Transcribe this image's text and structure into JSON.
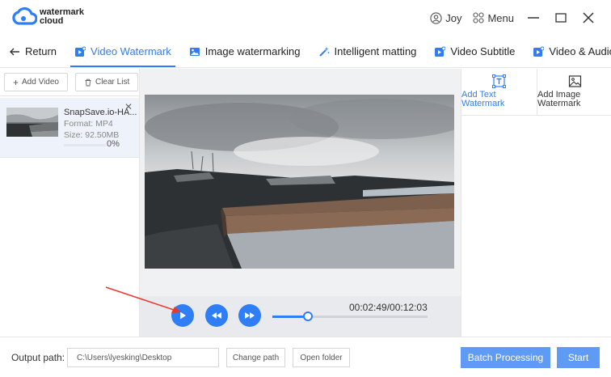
{
  "app": {
    "logo_line1": "watermark",
    "logo_line2": "cloud",
    "user_name": "Joy",
    "menu_label": "Menu",
    "accent_color": "#2f7ef5"
  },
  "tabs": [
    {
      "label": "Return",
      "icon": "arrow-left-icon"
    },
    {
      "label": "Video Watermark",
      "icon": "video-icon",
      "active": true
    },
    {
      "label": "Image watermarking",
      "icon": "image-icon"
    },
    {
      "label": "Intelligent matting",
      "icon": "magic-wand-icon"
    },
    {
      "label": "Video Subtitle",
      "icon": "video-subtitle-icon"
    },
    {
      "label": "Video & Audio Sepa",
      "icon": "video-audio-icon"
    }
  ],
  "left_panel": {
    "add_video_label": "Add Video",
    "clear_list_label": "Clear List",
    "file": {
      "name": "SnapSave.io-HA...",
      "format": "Format:  MP4",
      "size": "Size:  92.50MB",
      "progress": "0%",
      "progress_fraction": 0
    }
  },
  "player": {
    "time_display": "00:02:49/00:12:03",
    "position_fraction": 0.23
  },
  "right_panel": {
    "text_watermark_label": "Add Text Watermark",
    "image_watermark_label": "Add Image Watermark"
  },
  "bottom": {
    "output_label": "Output path:",
    "output_path": "C:\\Users\\lyesking\\Desktop",
    "change_path_label": "Change path",
    "open_folder_label": "Open folder",
    "batch_label": "Batch Processing",
    "start_label": "Start"
  }
}
